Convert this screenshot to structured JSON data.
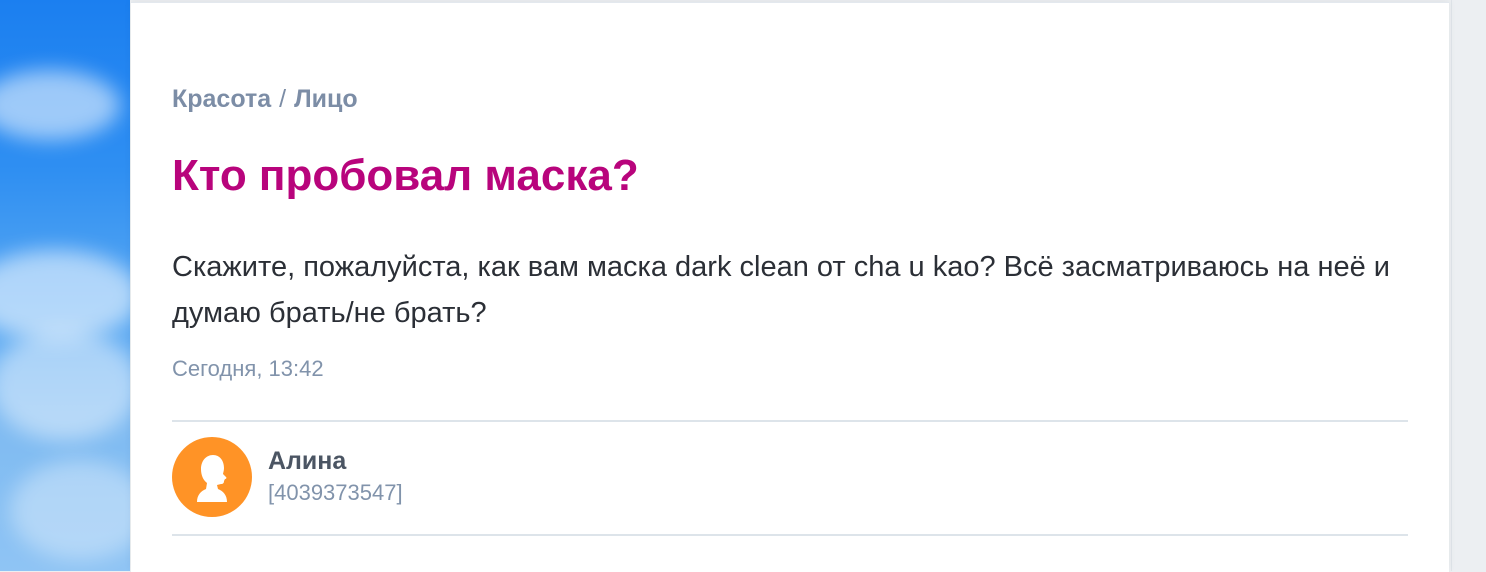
{
  "breadcrumb": {
    "category": "Красота",
    "separator": "/",
    "subcategory": "Лицо"
  },
  "post": {
    "title": "Кто пробовал маска?",
    "body": "Скажите, пожалуйста, как вам маска dark clean от cha u kao? Всё засматриваюсь на неё и думаю брать/не брать?",
    "timestamp": "Сегодня, 13:42"
  },
  "author": {
    "name": "Алина",
    "id": "[4039373547]",
    "avatar_icon": "user-silhouette-icon",
    "avatar_color": "#ff9326"
  },
  "colors": {
    "title": "#b8047c",
    "breadcrumb": "#7c8da6",
    "meta": "#8193ab",
    "text": "#2b2f36"
  }
}
